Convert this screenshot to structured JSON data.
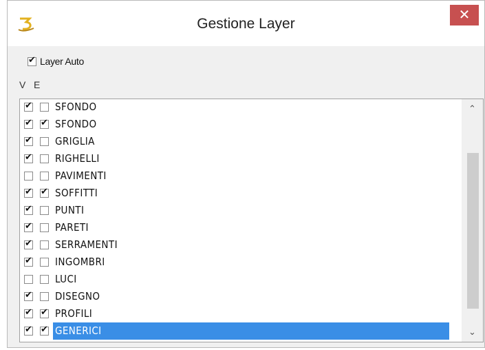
{
  "window": {
    "title": "Gestione Layer",
    "close_glyph": "✕",
    "icon": "app-logo-icon",
    "accent": "#c75050"
  },
  "layer_auto": {
    "label": "Layer Auto",
    "checked": true
  },
  "headers": {
    "v": "V",
    "e": "E"
  },
  "rows": [
    {
      "label": "SFONDO",
      "v": true,
      "e": false
    },
    {
      "label": "SFONDO",
      "v": true,
      "e": true
    },
    {
      "label": "GRIGLIA",
      "v": true,
      "e": false
    },
    {
      "label": "RIGHELLI",
      "v": true,
      "e": false
    },
    {
      "label": "PAVIMENTI",
      "v": false,
      "e": false
    },
    {
      "label": "SOFFITTI",
      "v": true,
      "e": true
    },
    {
      "label": "PUNTI",
      "v": true,
      "e": false
    },
    {
      "label": "PARETI",
      "v": true,
      "e": false
    },
    {
      "label": "SERRAMENTI",
      "v": true,
      "e": false
    },
    {
      "label": "INGOMBRI",
      "v": true,
      "e": false
    },
    {
      "label": "LUCI",
      "v": false,
      "e": false
    },
    {
      "label": "DISEGNO",
      "v": true,
      "e": false
    },
    {
      "label": "PROFILI",
      "v": true,
      "e": true
    },
    {
      "label": "GENERICI",
      "v": true,
      "e": true,
      "selected": true
    }
  ],
  "scroll": {
    "up_icon": "chevron-up-icon",
    "down_icon": "chevron-down-icon"
  },
  "colors": {
    "selection": "#3a8ee6"
  }
}
